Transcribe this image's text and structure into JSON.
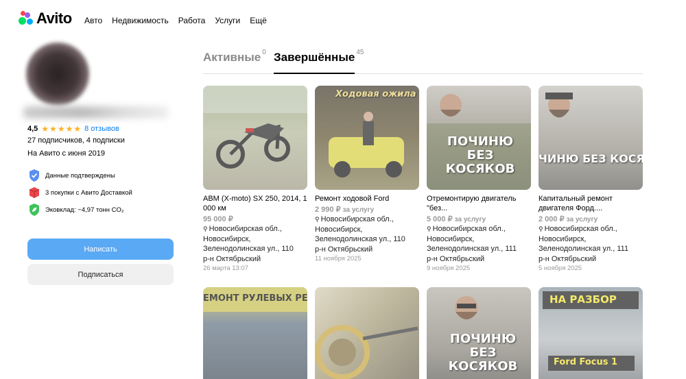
{
  "header": {
    "logo_text": "Avito",
    "nav": [
      "Авто",
      "Недвижимость",
      "Работа",
      "Услуги",
      "Ещё"
    ]
  },
  "profile": {
    "rating": "4,5",
    "stars": "★★★★★",
    "reviews": "8 отзывов",
    "subscribers": "27 подписчиков, 4 подписки",
    "since": "На Авито с июня 2019",
    "badges": [
      {
        "icon": "verified-shield-icon",
        "text": "Данные подтверждены"
      },
      {
        "icon": "delivery-box-icon",
        "text": "3 покупки с Авито Доставкой"
      },
      {
        "icon": "eco-leaf-icon",
        "text": "Эковклад: −4,97 тонн CO₂"
      }
    ],
    "write_button": "Написать",
    "subscribe_button": "Подписаться"
  },
  "tabs": {
    "active_label": "Активные",
    "active_count": "0",
    "done_label": "Завершённые",
    "done_count": "45"
  },
  "cards": [
    {
      "title": "ABM (X-moto) SX 250, 2014, 1 000 км",
      "price": "95 000 ₽",
      "price_suffix": "",
      "address": "Новосибирская обл., Новосибирск, Зеленодолинская ул., 110",
      "district": "р-н Октябрьский",
      "date": "26 марта 13:07"
    },
    {
      "title": "Ремонт ходовой Ford",
      "price": "2 990 ₽",
      "price_suffix": "за услугу",
      "address": "Новосибирская обл., Новосибирск, Зеленодолинская ул., 110",
      "district": "р-н Октябрьский",
      "date": "11 ноября 2025"
    },
    {
      "title": "Отремонтирую двигатель \"без...",
      "price": "5 000 ₽",
      "price_suffix": "за услугу",
      "address": "Новосибирская обл., Новосибирск, Зеленодолинская ул., 111",
      "district": "р-н Октябрьский",
      "date": "9 ноября 2025"
    },
    {
      "title": "Капитальный ремонт двигателя Форд....",
      "price": "2 000 ₽",
      "price_suffix": "за услугу",
      "address": "Новосибирская обл., Новосибирск, Зеленодолинская ул., 111",
      "district": "р-н Октябрьский",
      "date": "5 ноября 2025"
    }
  ],
  "image_texts": {
    "card2": "Ходовая ожила",
    "card3": "ПОЧИНЮ БЕЗ КОСЯКОВ",
    "card4": "ЧИНЮ БЕЗ КОСЯК",
    "card5": "ЕМОНТ РУЛЕВЫХ РЕЕ",
    "card7": "ПОЧИНЮ БЕЗ КОСЯКОВ",
    "card8_top": "НА РАЗБОР",
    "card8_bottom": "Ford Focus 1"
  },
  "colors": {
    "brand_blue": "#5aa9f4",
    "link_blue": "#0a7ff0",
    "star": "#ffb021"
  }
}
